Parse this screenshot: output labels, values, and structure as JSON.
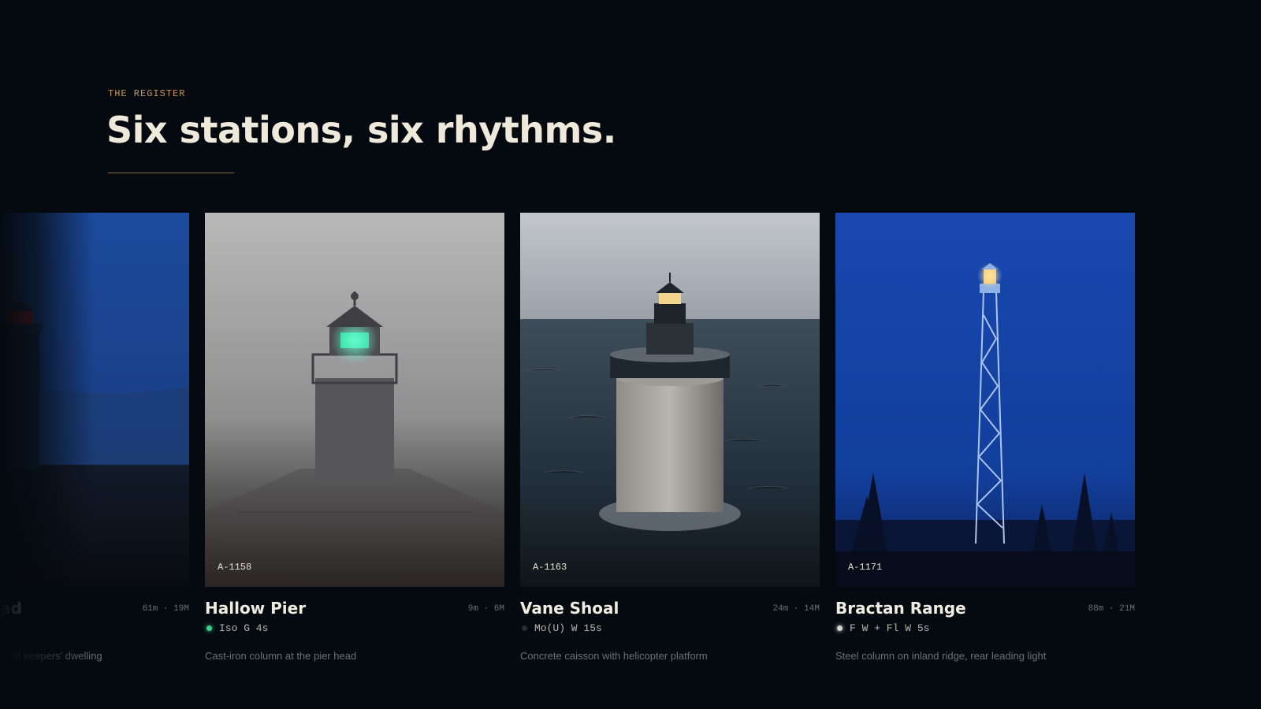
{
  "section": {
    "eyebrow": "THE REGISTER",
    "title": "Six stations, six rhythms."
  },
  "stations": [
    {
      "name": "ad",
      "stats": "61m · 19M",
      "character": "",
      "description": "…ith keepers' dwelling",
      "dot_color": "#7a3a36"
    },
    {
      "code": "A-1158",
      "name": "Hallow Pier",
      "stats": "9m · 6M",
      "character": "Iso G 4s",
      "description": "Cast-iron column at the pier head",
      "dot_color": "#3fd08a"
    },
    {
      "code": "A-1163",
      "name": "Vane Shoal",
      "stats": "24m · 14M",
      "character": "Mo(U) W 15s",
      "description": "Concrete caisson with helicopter platform",
      "dot_color": "#2a2d31"
    },
    {
      "code": "A-1171",
      "name": "Bractan Range",
      "stats": "88m · 21M",
      "character": "F W + Fl W 5s",
      "description": "Steel column on inland ridge, rear leading light",
      "dot_color": "#d9d6cf"
    }
  ],
  "colors": {
    "background": "#050a10",
    "accent": "#c9955b"
  }
}
